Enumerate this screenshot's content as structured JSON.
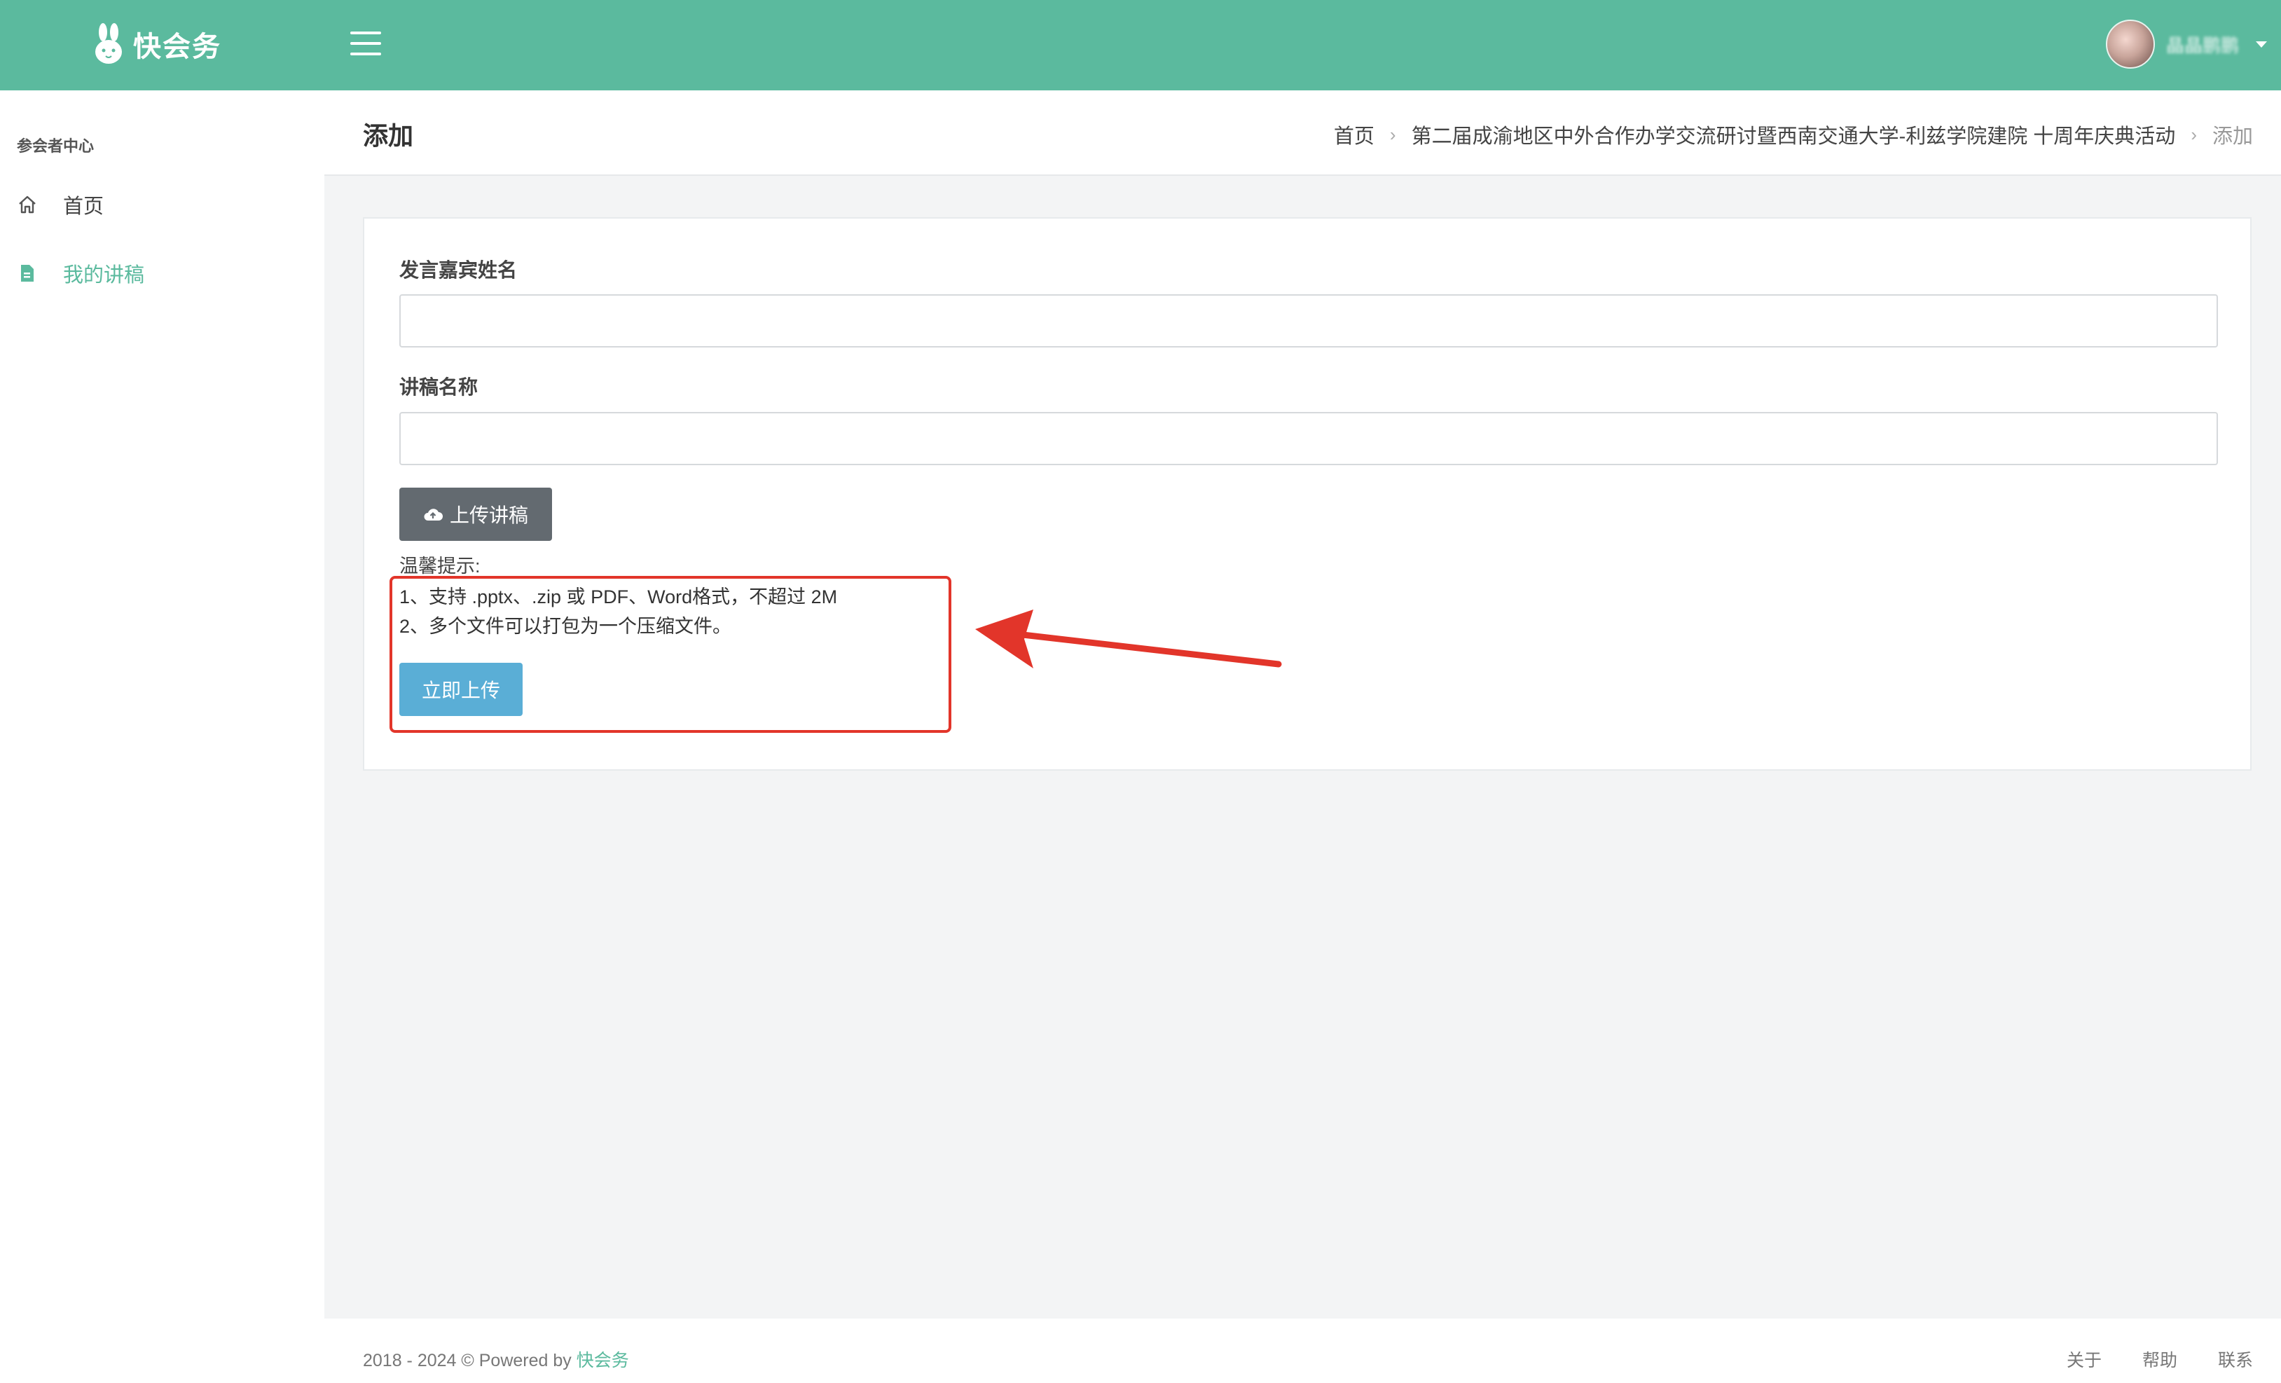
{
  "colors": {
    "brand": "#5bba9e",
    "upload_button": "#636a70",
    "submit_button": "#5aaed6",
    "annotation": "#e2352a"
  },
  "header": {
    "logo_text": "快会务",
    "logo_icon": "rabbit-icon",
    "menu_icon": "hamburger-icon",
    "username": "晶晶鹏鹏"
  },
  "sidebar": {
    "section_title": "参会者中心",
    "items": [
      {
        "label": "首页",
        "icon": "home-icon"
      },
      {
        "label": "我的讲稿",
        "icon": "document-icon",
        "active": true
      }
    ]
  },
  "page": {
    "title": "添加",
    "breadcrumb": [
      "首页",
      "第二届成渝地区中外合作办学交流研讨暨西南交通大学-利兹学院建院 十周年庆典活动",
      "添加"
    ]
  },
  "form": {
    "speaker_label": "发言嘉宾姓名",
    "speaker_value": "",
    "title_label": "讲稿名称",
    "title_value": "",
    "upload_button": "上传讲稿",
    "upload_icon": "cloud-upload-icon",
    "tips_title": "温馨提示:",
    "tips": [
      "1、支持 .pptx、.zip 或 PDF、Word格式，不超过 2M",
      "2、多个文件可以打包为一个压缩文件。"
    ],
    "submit_button": "立即上传"
  },
  "footer": {
    "copyright_prefix": "2018 - 2024 © Powered by ",
    "brand": "快会务",
    "links": [
      "关于",
      "帮助",
      "联系"
    ]
  }
}
